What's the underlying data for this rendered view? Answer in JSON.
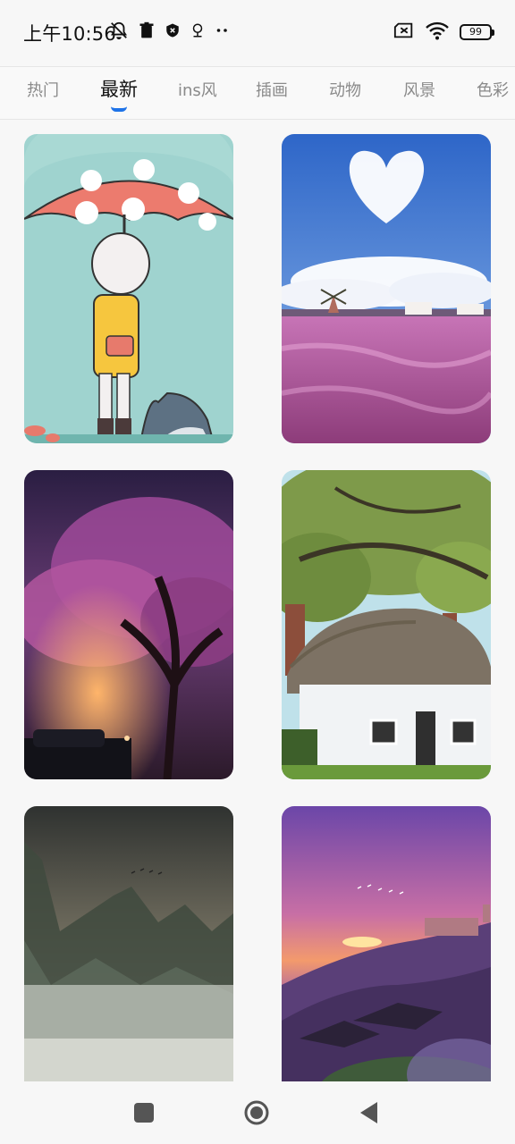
{
  "status_bar": {
    "time": "上午10:56",
    "battery_level": "99",
    "icons": [
      "notifications-off-icon",
      "trash-icon",
      "shield-icon",
      "location-icon",
      "more-icon",
      "sim-error-icon",
      "wifi-icon",
      "battery-icon"
    ]
  },
  "tabs": [
    {
      "label": "热门",
      "active": false
    },
    {
      "label": "最新",
      "active": true
    },
    {
      "label": "ins风",
      "active": false
    },
    {
      "label": "插画",
      "active": false
    },
    {
      "label": "动物",
      "active": false
    },
    {
      "label": "风景",
      "active": false
    },
    {
      "label": "色彩",
      "active": false
    }
  ],
  "accent_color": "#1e73e8",
  "wallpapers": [
    {
      "subject": "illustration-girl-umbrella-shark"
    },
    {
      "subject": "pink-field-windmill-heart-cloud"
    },
    {
      "subject": "purple-blossom-tree-night"
    },
    {
      "subject": "thatched-cottage-under-trees"
    },
    {
      "subject": "misty-mountains"
    },
    {
      "subject": "sunset-hill-village"
    }
  ],
  "nav": {
    "buttons": [
      "recents-square-icon",
      "home-circle-icon",
      "back-triangle-icon"
    ]
  }
}
